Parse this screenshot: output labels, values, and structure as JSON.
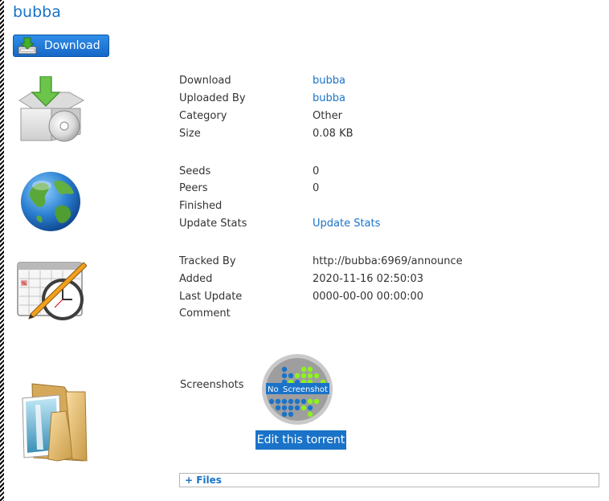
{
  "title": "bubba",
  "download_button": {
    "label": "Download",
    "icon": "download-tray-icon"
  },
  "section1": {
    "icon": "package-disc-icon",
    "rows": [
      {
        "label": "Download",
        "value": "bubba"
      },
      {
        "label": "Uploaded By",
        "value": "bubba"
      },
      {
        "label": "Category",
        "value": "Other"
      },
      {
        "label": "Size",
        "value": "0.08 KB"
      }
    ]
  },
  "section2": {
    "icon": "globe-icon",
    "rows": [
      {
        "label": "Seeds",
        "value": "0"
      },
      {
        "label": "Peers",
        "value": "0"
      },
      {
        "label": "Finished",
        "value": ""
      },
      {
        "label": "Update Stats",
        "value": "Update Stats"
      }
    ]
  },
  "section3": {
    "icon": "calendar-clock-icon",
    "rows": [
      {
        "label": "Tracked By",
        "value": "http://bubba:6969/announce"
      },
      {
        "label": "Added",
        "value": "2020-11-16 02:50:03"
      },
      {
        "label": "Last Update",
        "value": "0000-00-00 00:00:00"
      },
      {
        "label": "Comment",
        "value": ""
      }
    ]
  },
  "section4": {
    "icon": "folder-images-icon",
    "label": "Screenshots",
    "placeholder": {
      "word1": "No",
      "word2": "Screenshot"
    },
    "edit_button": "Edit this torrent"
  },
  "files_toggle": "+ Files",
  "colors": {
    "link": "#1a73c8",
    "button": "#1a73c8"
  }
}
